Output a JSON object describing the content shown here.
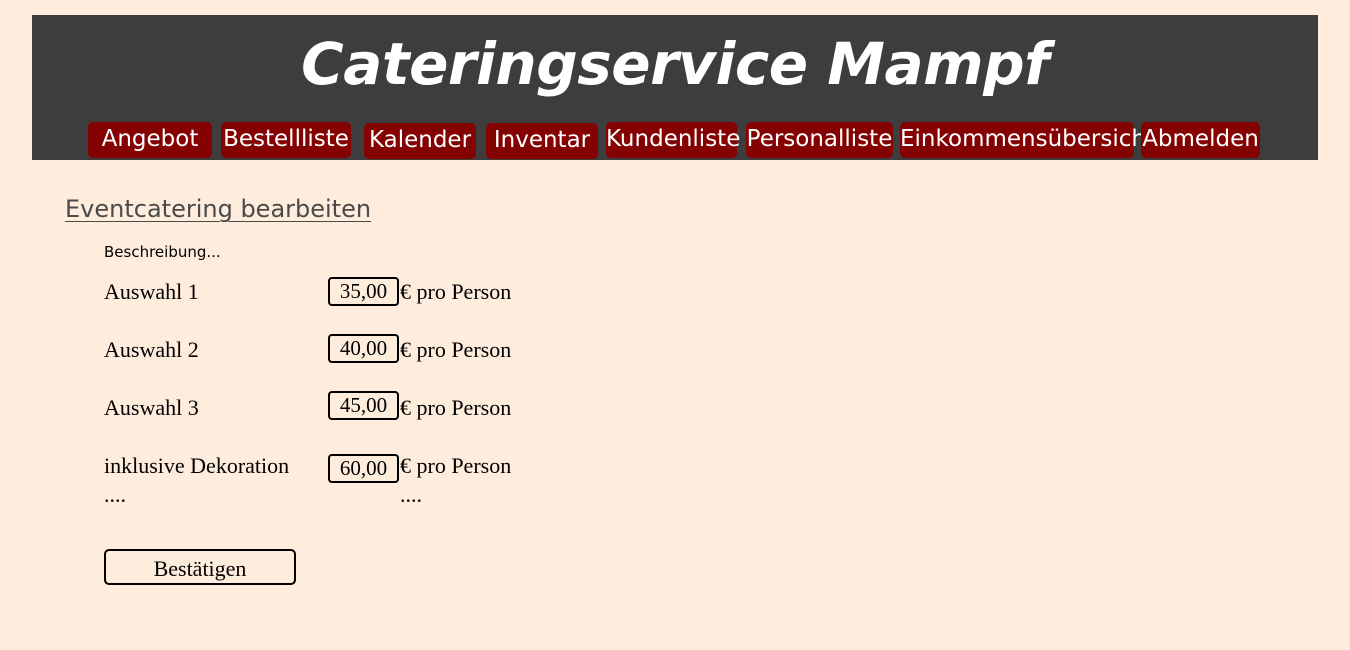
{
  "header": {
    "title": "Cateringservice Mampf",
    "nav": [
      {
        "label": "Angebot"
      },
      {
        "label": "Bestellliste"
      },
      {
        "label": "Kalender"
      },
      {
        "label": "Inventar"
      },
      {
        "label": "Kundenliste"
      },
      {
        "label": "Personalliste"
      },
      {
        "label": "Einkommensübersicht"
      },
      {
        "label": "Abmelden"
      }
    ]
  },
  "main": {
    "section_title": "Eventcatering bearbeiten",
    "description": "Beschreibung...",
    "options": [
      {
        "label": "Auswahl 1",
        "price": "35,00",
        "unit": "€ pro Person"
      },
      {
        "label": "Auswahl 2",
        "price": "40,00",
        "unit": "€ pro Person"
      },
      {
        "label": "Auswahl 3",
        "price": "45,00",
        "unit": "€ pro Person"
      },
      {
        "label": "inklusive Dekoration",
        "price": "60,00",
        "unit": "€ pro Person"
      }
    ],
    "ellipsis_left": "....",
    "ellipsis_right": "....",
    "confirm_label": "Bestätigen"
  },
  "colors": {
    "background": "#feecdc",
    "header": "#3d3d3d",
    "nav_button": "#840202"
  }
}
